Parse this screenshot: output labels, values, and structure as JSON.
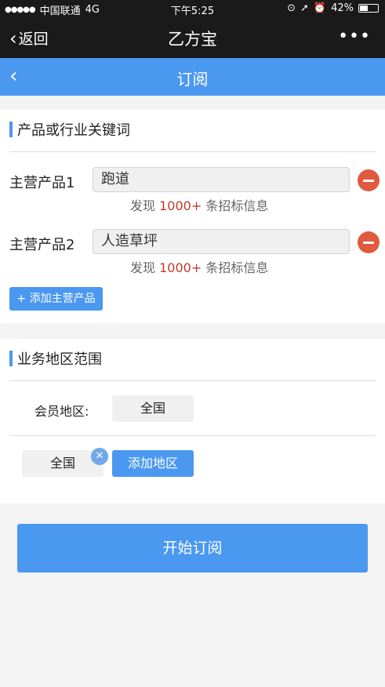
{
  "status_bar": {
    "carrier": "中国联通",
    "network": "4G",
    "time": "下午5:25",
    "battery": "42%",
    "battery_level": 0.42
  },
  "nav_bar": {
    "back_label": "返回",
    "title": "乙方宝",
    "more_label": "•••"
  },
  "header": {
    "title": "订阅"
  },
  "keywords_section": {
    "title": "产品或行业关键词",
    "products": [
      {
        "label": "主营产品1",
        "value": "跑道",
        "hint_prefix": "发现",
        "hint_count": "1000+",
        "hint_suffix": "条招标信息"
      },
      {
        "label": "主营产品2",
        "value": "人造草坪",
        "hint_prefix": "发现",
        "hint_count": "1000+",
        "hint_suffix": "条招标信息"
      }
    ],
    "add_button_label": "+ 添加主营产品"
  },
  "region_section": {
    "title": "业务地区范围",
    "member_label": "会员地区:",
    "member_value": "全国",
    "selected_region": "全国",
    "add_region_label": "添加地区"
  },
  "submit_label": "开始订阅",
  "colors": {
    "accent": "#4a98f0",
    "danger": "#e05a3e",
    "dark_bar": "#1a1a1a"
  }
}
